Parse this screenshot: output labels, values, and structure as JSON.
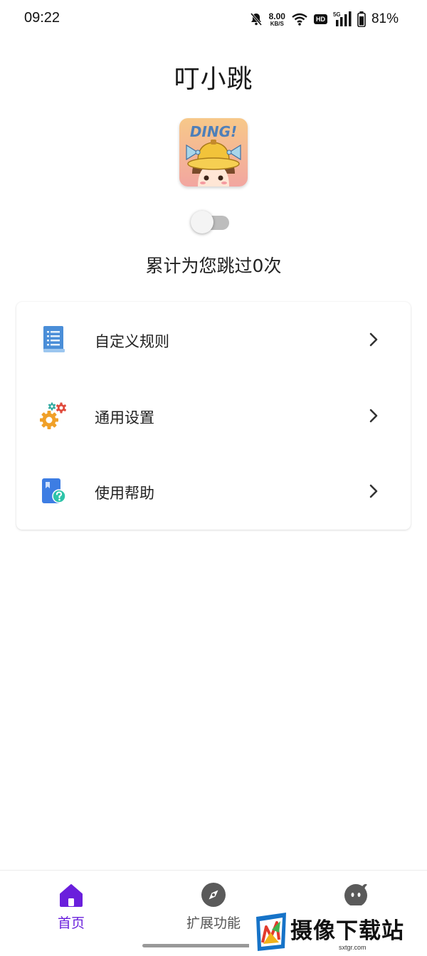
{
  "status_bar": {
    "time": "09:22",
    "net_speed_value": "8.00",
    "net_speed_unit": "KB/S",
    "hd_badge": "HD",
    "network_type": "5G",
    "battery_percent": "81%"
  },
  "header": {
    "title": "叮小跳"
  },
  "logo": {
    "text": "DING!"
  },
  "toggle": {
    "state": "off"
  },
  "stats": {
    "skip_count_text": "累计为您跳过0次"
  },
  "menu": {
    "items": [
      {
        "label": "自定义规则",
        "icon": "document-list-icon"
      },
      {
        "label": "通用设置",
        "icon": "gears-icon"
      },
      {
        "label": "使用帮助",
        "icon": "help-book-icon"
      }
    ]
  },
  "bottom_nav": {
    "items": [
      {
        "label": "首页",
        "icon": "home-icon",
        "active": true
      },
      {
        "label": "扩展功能",
        "icon": "compass-icon",
        "active": false
      },
      {
        "label": "",
        "icon": "mascot-face-icon",
        "active": false
      }
    ]
  },
  "watermark": {
    "text": "摄像下载站",
    "subtext": "sxtgr.com"
  },
  "colors": {
    "accent": "#6a1fdc",
    "toggle_track": "#bdbdbd",
    "toggle_thumb": "#f4f4f4"
  }
}
